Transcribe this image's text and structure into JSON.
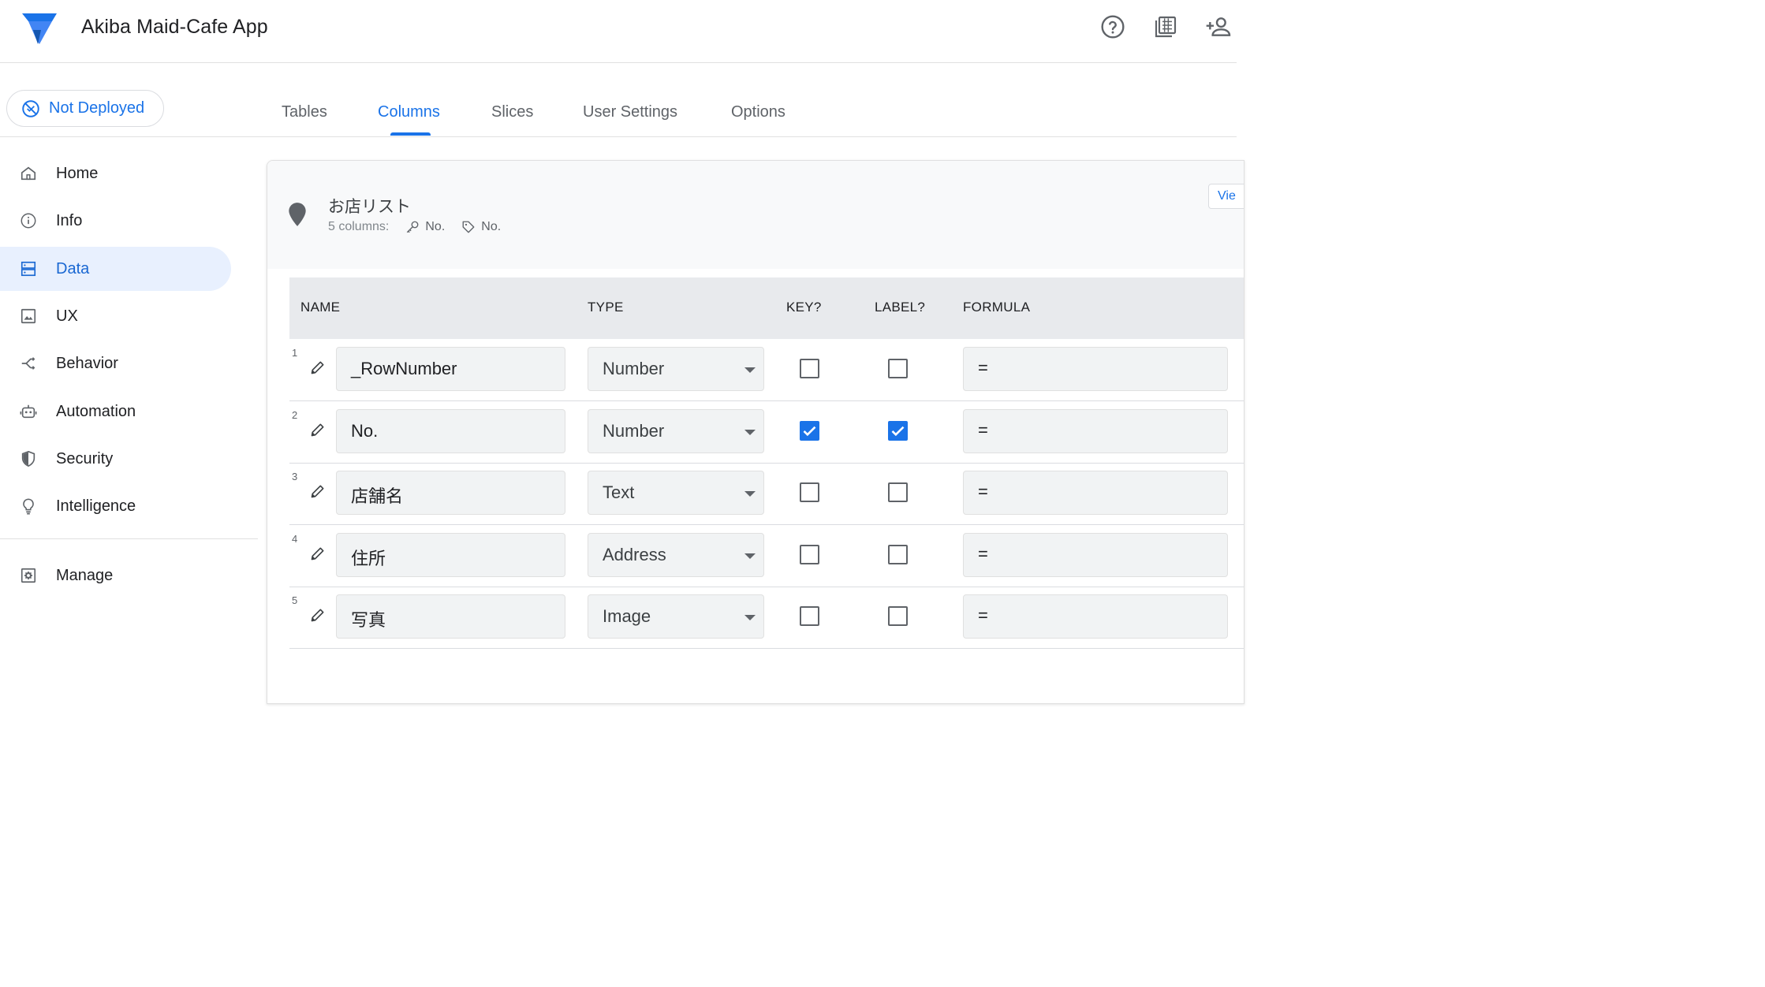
{
  "app": {
    "title": "Akiba Maid-Cafe App"
  },
  "deploy": {
    "status": "Not Deployed"
  },
  "tabs": [
    {
      "label": "Tables",
      "active": false
    },
    {
      "label": "Columns",
      "active": true
    },
    {
      "label": "Slices",
      "active": false
    },
    {
      "label": "User Settings",
      "active": false
    },
    {
      "label": "Options",
      "active": false
    }
  ],
  "sidebar": {
    "items": [
      {
        "label": "Home",
        "icon": "home-icon",
        "active": false
      },
      {
        "label": "Info",
        "icon": "info-icon",
        "active": false
      },
      {
        "label": "Data",
        "icon": "data-icon",
        "active": true
      },
      {
        "label": "UX",
        "icon": "ux-icon",
        "active": false
      },
      {
        "label": "Behavior",
        "icon": "behavior-icon",
        "active": false
      },
      {
        "label": "Automation",
        "icon": "automation-icon",
        "active": false
      },
      {
        "label": "Security",
        "icon": "security-icon",
        "active": false
      },
      {
        "label": "Intelligence",
        "icon": "intelligence-icon",
        "active": false
      }
    ],
    "manage": {
      "label": "Manage",
      "icon": "manage-icon"
    }
  },
  "table": {
    "name": "お店リスト",
    "columns_count": "5 columns:",
    "key_column": "No.",
    "label_column": "No.",
    "view_button": "Vie"
  },
  "columns_header": {
    "name": "NAME",
    "type": "TYPE",
    "key": "KEY?",
    "label": "LABEL?",
    "formula": "FORMULA"
  },
  "rows": [
    {
      "num": "1",
      "name": "_RowNumber",
      "type": "Number",
      "key": false,
      "label": false,
      "formula": "="
    },
    {
      "num": "2",
      "name": "No.",
      "type": "Number",
      "key": true,
      "label": true,
      "formula": "="
    },
    {
      "num": "3",
      "name": "店舗名",
      "type": "Text",
      "key": false,
      "label": false,
      "formula": "="
    },
    {
      "num": "4",
      "name": "住所",
      "type": "Address",
      "key": false,
      "label": false,
      "formula": "="
    },
    {
      "num": "5",
      "name": "写真",
      "type": "Image",
      "key": false,
      "label": false,
      "formula": "="
    }
  ],
  "colors": {
    "accent": "#1a73e8",
    "active_bg": "#e8f0fe",
    "header_bg": "#e8eaed",
    "field_bg": "#f1f3f4"
  }
}
